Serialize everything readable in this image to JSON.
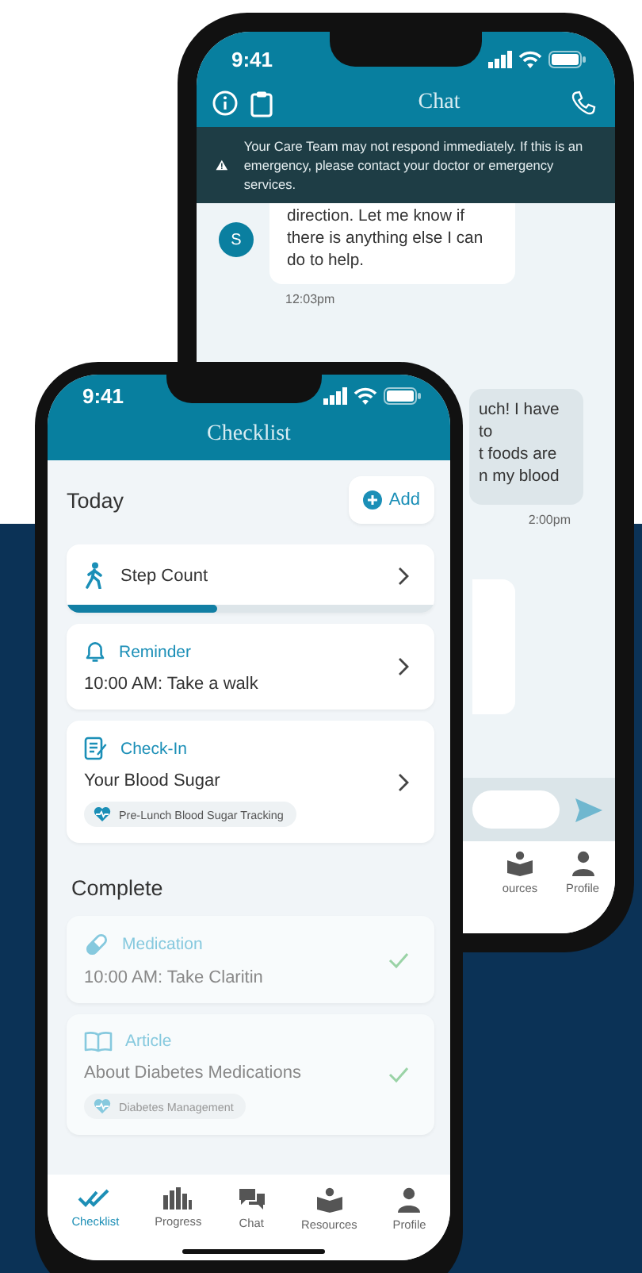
{
  "chat_phone": {
    "status_bar": {
      "time": "9:41"
    },
    "title": "Chat",
    "notice": "Your Care Team may not respond immediately. If this is an emergency, please contact your doctor or emergency services.",
    "messages": [
      {
        "kind": "received",
        "avatar": "S",
        "text": "direction. Let me know if\nthere is anything else I can\ndo to help.",
        "time": "12:03pm"
      },
      {
        "kind": "sent",
        "text": "uch! I have\nto\nt foods are\nn my blood",
        "time": "2:00pm"
      },
      {
        "kind": "received"
      }
    ],
    "tabs": [
      {
        "kind": "resources",
        "label": "ources",
        "selected": false
      },
      {
        "kind": "profile",
        "label": "Profile",
        "selected": false
      }
    ]
  },
  "checklist_phone": {
    "status_bar": {
      "time": "9:41"
    },
    "title": "Checklist",
    "today": {
      "heading": "Today",
      "add_button": "Add",
      "items": [
        {
          "kind": "progress",
          "title": "Step Count",
          "level": 0.41,
          "completed": false
        },
        {
          "kind": "reminder",
          "category": "Reminder",
          "title": "10:00 AM: Take a walk",
          "completed": false
        },
        {
          "kind": "check_in",
          "category": "Check-In",
          "title": "Your Blood Sugar",
          "tag": "Pre-Lunch Blood Sugar Tracking",
          "completed": false
        }
      ]
    },
    "complete": {
      "heading": "Complete",
      "items": [
        {
          "kind": "medication",
          "category": "Medication",
          "title": "10:00 AM: Take Claritin",
          "completed": true
        },
        {
          "kind": "article",
          "category": "Article",
          "title": "About Diabetes Medications",
          "tag": "Diabetes Management",
          "completed": true
        }
      ]
    },
    "tabs": [
      {
        "kind": "checklist",
        "label": "Checklist",
        "selected": true
      },
      {
        "kind": "progress",
        "label": "Progress",
        "selected": false
      },
      {
        "kind": "chat",
        "label": "Chat",
        "selected": false
      },
      {
        "kind": "resources",
        "label": "Resources",
        "selected": false
      },
      {
        "kind": "profile",
        "label": "Profile",
        "selected": false
      }
    ]
  }
}
